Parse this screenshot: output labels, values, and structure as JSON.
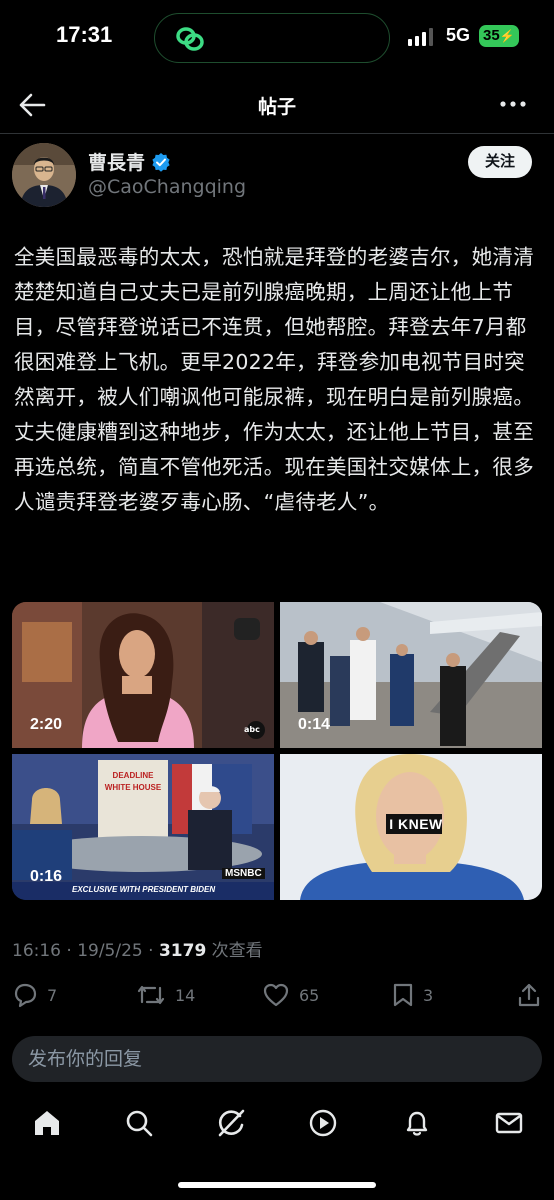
{
  "status_bar": {
    "time": "17:31",
    "network": "5G",
    "battery": "35"
  },
  "nav": {
    "title": "帖子"
  },
  "author": {
    "name": "曹長青",
    "handle": "@CaoChangqing",
    "follow_label": "关注"
  },
  "post": {
    "text": "全美国最恶毒的太太，恐怕就是拜登的老婆吉尔，她清清楚楚知道自己丈夫已是前列腺癌晚期，上周还让他上节目，尽管拜登说话已不连贯，但她帮腔。拜登去年7月都很困难登上飞机。更早2022年，拜登参加电视节目时突然离开，被人们嘲讽他可能尿裤，现在明白是前列腺癌。丈夫健康糟到这种地步，作为太太，还让他上节目，甚至再选总统，简直不管他死活。现在美国社交媒体上，很多人谴责拜登老婆歹毒心肠、“虐待老人”。"
  },
  "media": [
    {
      "duration": "2:20",
      "overlay": "abc"
    },
    {
      "duration": "0:14"
    },
    {
      "duration": "0:16",
      "banner": "EXCLUSIVE WITH PRESIDENT BIDEN",
      "sign": "DEADLINE WHITE HOUSE",
      "network": "MSNBC"
    },
    {
      "caption": "I KNEW"
    }
  ],
  "meta": {
    "time": "16:16 · 19/5/25 · ",
    "views": "3179",
    "views_label": " 次查看"
  },
  "actions": {
    "replies": "7",
    "reposts": "14",
    "likes": "65",
    "bookmarks": "3"
  },
  "reply_box": {
    "placeholder": "发布你的回复"
  },
  "colors": {
    "background": "#000000",
    "text": "#e7e9ea",
    "muted": "#71767b",
    "verified": "#1d9bf0",
    "battery": "#34c759"
  }
}
